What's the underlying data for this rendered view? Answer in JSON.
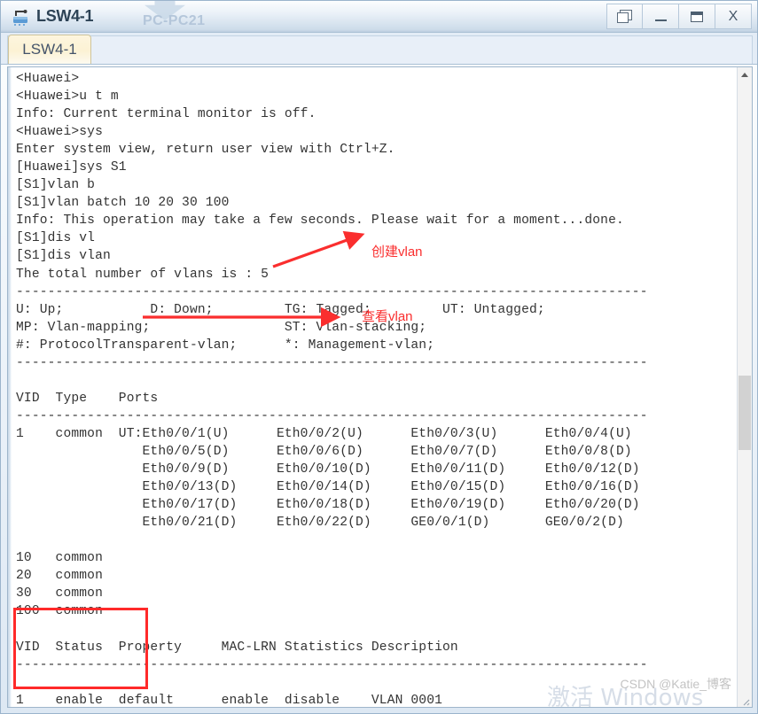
{
  "window": {
    "title": "LSW4-1",
    "icon": "switch-icon",
    "background_watermark": "PC-PC21",
    "controls": [
      {
        "name": "restore-button",
        "glyph": "cascade"
      },
      {
        "name": "minimize-button",
        "glyph": "minimize"
      },
      {
        "name": "maximize-button",
        "glyph": "maximize"
      },
      {
        "name": "close-button",
        "glyph": "X"
      }
    ]
  },
  "tabs": [
    {
      "label": "LSW4-1",
      "active": true
    }
  ],
  "terminal": {
    "lines": [
      "<Huawei>",
      "<Huawei>u t m",
      "Info: Current terminal monitor is off.",
      "<Huawei>sys",
      "Enter system view, return user view with Ctrl+Z.",
      "[Huawei]sys S1",
      "[S1]vlan b",
      "[S1]vlan batch 10 20 30 100",
      "Info: This operation may take a few seconds. Please wait for a moment...done.",
      "[S1]dis vl",
      "[S1]dis vlan",
      "The total number of vlans is : 5",
      "--------------------------------------------------------------------------------",
      "U: Up;           D: Down;         TG: Tagged;         UT: Untagged;",
      "MP: Vlan-mapping;                 ST: Vlan-stacking;",
      "#: ProtocolTransparent-vlan;      *: Management-vlan;",
      "--------------------------------------------------------------------------------",
      "",
      "VID  Type    Ports",
      "--------------------------------------------------------------------------------",
      "1    common  UT:Eth0/0/1(U)      Eth0/0/2(U)      Eth0/0/3(U)      Eth0/0/4(U)",
      "                Eth0/0/5(D)      Eth0/0/6(D)      Eth0/0/7(D)      Eth0/0/8(D)",
      "                Eth0/0/9(D)      Eth0/0/10(D)     Eth0/0/11(D)     Eth0/0/12(D)",
      "                Eth0/0/13(D)     Eth0/0/14(D)     Eth0/0/15(D)     Eth0/0/16(D)",
      "                Eth0/0/17(D)     Eth0/0/18(D)     Eth0/0/19(D)     Eth0/0/20(D)",
      "                Eth0/0/21(D)     Eth0/0/22(D)     GE0/0/1(D)       GE0/0/2(D)",
      "",
      "10   common",
      "20   common",
      "30   common",
      "100  common",
      "",
      "VID  Status  Property     MAC-LRN Statistics Description",
      "--------------------------------------------------------------------------------",
      "",
      "1    enable  default      enable  disable    VLAN 0001"
    ]
  },
  "annotations": [
    {
      "name": "create-vlan-annotation",
      "label": "创建vlan",
      "arrow": "diagonal-up-right",
      "color": "#fa2e2e"
    },
    {
      "name": "view-vlan-annotation",
      "label": "查看vlan",
      "arrow": "horizontal-right",
      "color": "#fa2e2e"
    }
  ],
  "highlight_box": {
    "name": "created-vlans-highlight",
    "color": "#ff2a2a",
    "rows": [
      "10   common",
      "20   common",
      "30   common",
      "100  common"
    ]
  },
  "scrollbar": {
    "up_arrow": "chevron-up-icon",
    "thumb_position_percent": 48
  },
  "watermarks": {
    "csdn": "CSDN @Katie_博客",
    "activate_windows": "激活 Windows"
  }
}
